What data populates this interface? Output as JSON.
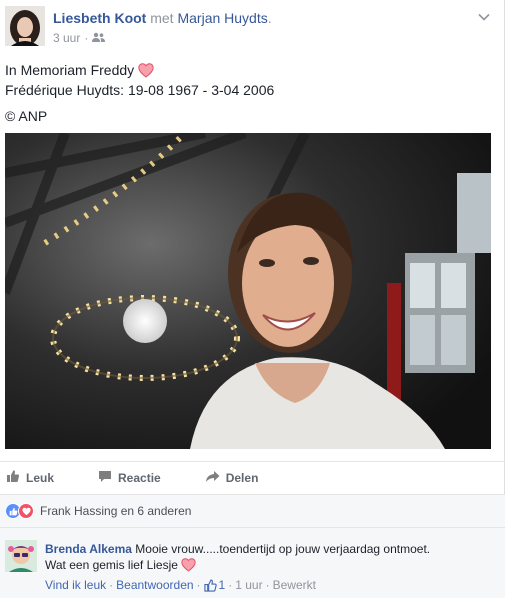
{
  "post": {
    "author": "Liesbeth Koot",
    "with_word": "met",
    "tagged": "Marjan Huydts",
    "tagged_suffix": ".",
    "time": "3 uur",
    "meta_sep": "·",
    "privacy_icon": "friends-icon",
    "lines": [
      "In Memoriam Freddy",
      "Frédérique Huydts: 19-08 1967 - 3-04 2006",
      "© ANP"
    ],
    "heart_color": "#f25268"
  },
  "actions": {
    "like": "Leuk",
    "comment": "Reactie",
    "share": "Delen"
  },
  "reactions": {
    "summary": "Frank Hassing en 6 anderen",
    "like_color": "#5890ff",
    "love_color": "#f25268"
  },
  "comment": {
    "author": "Brenda Alkema",
    "text_line1": "Mooie vrouw.....toendertijd op jouw verjaardag ontmoet.",
    "text_line2": "Wat een gemis lief Liesje",
    "like_link": "Vind ik leuk",
    "sep": "·",
    "reply_link": "Beantwoorden",
    "like_count": "1",
    "time": "1 uur",
    "edited": "Bewerkt"
  },
  "colors": {
    "link": "#365899",
    "muted": "#90949c",
    "action": "#616770"
  }
}
